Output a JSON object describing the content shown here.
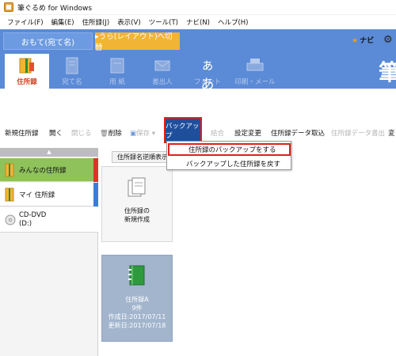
{
  "window": {
    "title": "筆ぐるめ for Windows"
  },
  "menu": [
    "ファイル(F)",
    "編集(E)",
    "住所録(J)",
    "表示(V)",
    "ツール(T)",
    "ナビ(N)",
    "ヘルプ(H)"
  ],
  "tabs": {
    "front": "おもて(宛て名)",
    "back": "▸うら(レイアウト)へ切替"
  },
  "navi": "ナビ",
  "modes": [
    "住所録",
    "宛て名",
    "用 紙",
    "差出人",
    "フォント",
    "印刷・メール"
  ],
  "app_char": "筆",
  "toolbar": {
    "new_book": "新規住所録",
    "open": "開く",
    "close": "閉じる",
    "delete": "削除",
    "save": "保存",
    "backup": "バックアップ",
    "merge": "結合",
    "settings": "設定変更",
    "import": "住所録データ取込",
    "export": "住所録データ書出",
    "more": "変"
  },
  "sidebar": {
    "items": [
      {
        "label": "みんなの住所録"
      },
      {
        "label": "マイ 住所録"
      },
      {
        "label": "CD-DVD",
        "sub": "(D:)"
      }
    ]
  },
  "main": {
    "sort_label": "住所録名逆順表示",
    "new_card": {
      "line1": "住所録の",
      "line2": "新規作成"
    },
    "book_card": {
      "name": "住所録A",
      "count": "9件",
      "created": "作成日:2017/07/11",
      "updated": "更新日:2017/07/18"
    }
  },
  "dropdown": {
    "items": [
      "住所録のバックアップをする",
      "バックアップした住所録を戻す"
    ]
  },
  "colors": {
    "accent_blue": "#5b8bd6",
    "highlight_red": "#e0201b",
    "tab_orange": "#f2b434"
  }
}
